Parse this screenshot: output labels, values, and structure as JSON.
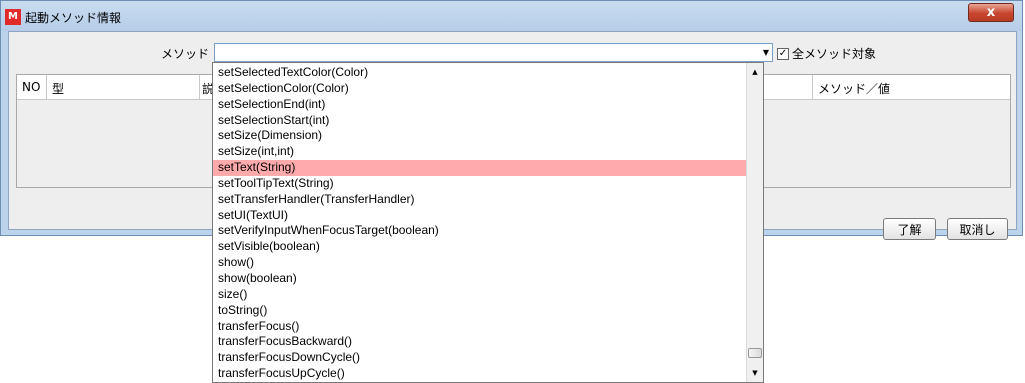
{
  "window": {
    "title": "起動メソッド情報",
    "icon_letter": "M",
    "close_glyph": "x"
  },
  "form": {
    "method_label": "メソッド",
    "combo_value": "",
    "combo_arrow": "▼",
    "all_methods_label": "全メソッド対象",
    "all_methods_checked": true,
    "check_glyph": "✓"
  },
  "table": {
    "columns": [
      "NO",
      "型",
      "説",
      "メソッド／値"
    ]
  },
  "buttons": {
    "ok_label": "了解",
    "cancel_label": "取消し"
  },
  "dropdown": {
    "selected_index": 6,
    "scroll_up_glyph": "▲",
    "scroll_down_glyph": "▼",
    "scroll_position": 0.97,
    "items": [
      "setSelectedTextColor(Color)",
      "setSelectionColor(Color)",
      "setSelectionEnd(int)",
      "setSelectionStart(int)",
      "setSize(Dimension)",
      "setSize(int,int)",
      "setText(String)",
      "setToolTipText(String)",
      "setTransferHandler(TransferHandler)",
      "setUI(TextUI)",
      "setVerifyInputWhenFocusTarget(boolean)",
      "setVisible(boolean)",
      "show()",
      "show(boolean)",
      "size()",
      "toString()",
      "transferFocus()",
      "transferFocusBackward()",
      "transferFocusDownCycle()",
      "transferFocusUpCycle()"
    ]
  }
}
